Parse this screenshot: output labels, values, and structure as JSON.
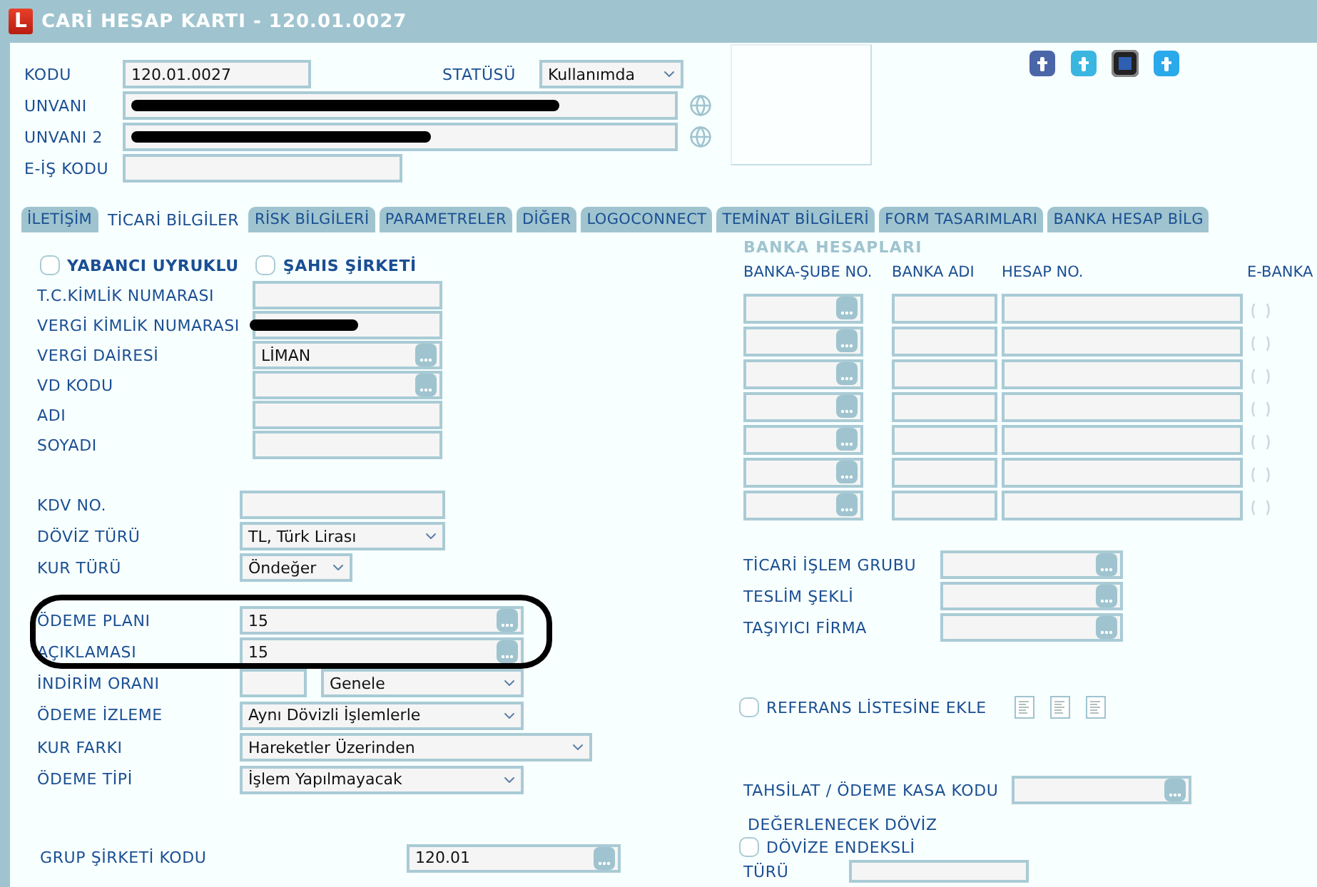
{
  "window": {
    "logo": "L",
    "title": "CARİ HESAP KARTI - 120.01.0027"
  },
  "header": {
    "code": {
      "label": "KODU",
      "value": "120.01.0027"
    },
    "status": {
      "label": "STATÜSÜ",
      "value": "Kullanımda"
    },
    "titles": [
      {
        "label": "UNVANI",
        "redacted": true
      },
      {
        "label": "UNVANI 2",
        "redacted": true
      }
    ],
    "e_code": {
      "label": "E-İŞ KODU"
    }
  },
  "tabs": [
    {
      "label": "İLETİŞİM",
      "selected": false
    },
    {
      "label": "TİCARİ BİLGİLER",
      "selected": true
    },
    {
      "label": "RİSK BİLGİLERİ",
      "selected": false
    },
    {
      "label": "PARAMETRELER",
      "selected": false
    },
    {
      "label": "DİĞER",
      "selected": false
    },
    {
      "label": "LOGOCONNECT",
      "selected": false
    },
    {
      "label": "TEMİNAT BİLGİLERİ",
      "selected": false
    },
    {
      "label": "FORM TASARIMLARI",
      "selected": false
    },
    {
      "label": "BANKA HESAP BİLG",
      "selected": false
    }
  ],
  "left": {
    "checkboxes": [
      {
        "label": "YABANCI UYRUKLU",
        "checked": false
      },
      {
        "label": "ŞAHIS ŞİRKETİ",
        "checked": false
      }
    ],
    "identity": [
      {
        "label": "T.C.KİMLİK NUMARASI",
        "kind": "text"
      },
      {
        "label": "VERGİ KİMLİK NUMARASI",
        "kind": "text",
        "redacted": true
      },
      {
        "label": "VERGİ DAİRESİ",
        "kind": "lookup",
        "value": "LİMAN"
      },
      {
        "label": "VD KODU",
        "kind": "lookup"
      },
      {
        "label": "ADI",
        "kind": "text"
      },
      {
        "label": "SOYADI",
        "kind": "text"
      }
    ],
    "currency": [
      {
        "label": "KDV NO.",
        "kind": "text"
      },
      {
        "label": "DÖVİZ TÜRÜ",
        "kind": "select",
        "value": "TL, Türk Lirası"
      },
      {
        "label": "KUR TÜRÜ",
        "kind": "select",
        "value": "Öndeğer"
      }
    ],
    "payment_plan": {
      "highlighted": true,
      "fields": [
        {
          "label": "ÖDEME PLANI",
          "kind": "lookup",
          "value": "15"
        },
        {
          "label": "AÇIKLAMASI",
          "kind": "lookup",
          "value": "15"
        }
      ]
    },
    "payment": [
      {
        "label": "İNDİRİM ORANI",
        "kind": "split",
        "value": "Genele"
      },
      {
        "label": "ÖDEME İZLEME",
        "kind": "select",
        "value": "Aynı Dövizli İşlemlerle"
      },
      {
        "label": "KUR FARKI",
        "kind": "wide_select",
        "value": "Hareketler Üzerinden"
      },
      {
        "label": "ÖDEME TİPİ",
        "kind": "select",
        "value": "İşlem Yapılmayacak"
      }
    ],
    "group_company": {
      "label": "GRUP ŞİRKETİ KODU",
      "value": "120.01"
    }
  },
  "right": {
    "bank_accounts": {
      "title": "BANKA HESAPLARI",
      "columns": [
        "BANKA-ŞUBE NO.",
        "BANKA ADI",
        "HESAP NO.",
        "E-BANKA"
      ],
      "rows": [
        {
          "checked": false
        },
        {
          "checked": false
        },
        {
          "checked": false
        },
        {
          "checked": false
        },
        {
          "checked": false
        },
        {
          "checked": false
        },
        {
          "checked": false
        }
      ]
    },
    "trade": [
      {
        "label": "TİCARİ İŞLEM GRUBU"
      },
      {
        "label": "TESLİM ŞEKLİ"
      },
      {
        "label": "TAŞIYICI FİRMA"
      }
    ],
    "reference": {
      "label": "REFERANS LİSTESİNE EKLE",
      "checked": false
    },
    "cash_code": {
      "label": "TAHSİLAT / ÖDEME KASA KODU"
    },
    "valuation": {
      "title": "DEĞERLENECEK DÖVİZ",
      "checkbox": {
        "label": "DÖVİZE ENDEKSLİ",
        "checked": false
      },
      "type_label": "TÜRÜ"
    }
  }
}
